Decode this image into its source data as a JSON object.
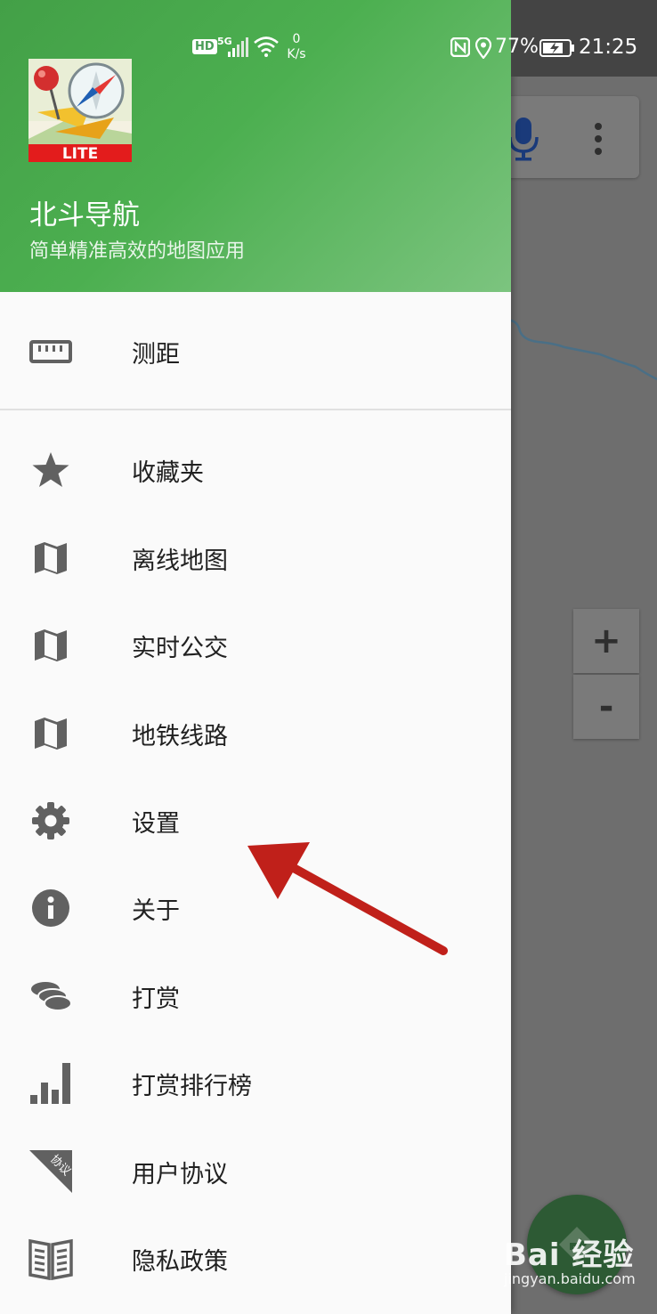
{
  "status_bar": {
    "hd": "HD",
    "network": "5G",
    "speed_value": "0",
    "speed_unit": "K/s",
    "battery": "77%",
    "time": "21:25"
  },
  "header": {
    "app_title": "北斗导航",
    "app_subtitle": "简单精准高效的地图应用",
    "logo_badge": "LITE"
  },
  "menu": {
    "top_items": [
      {
        "label": "测距",
        "icon": "ruler-icon"
      }
    ],
    "items": [
      {
        "label": "收藏夹",
        "icon": "star-icon"
      },
      {
        "label": "离线地图",
        "icon": "map-icon"
      },
      {
        "label": "实时公交",
        "icon": "map-icon"
      },
      {
        "label": "地铁线路",
        "icon": "map-icon"
      },
      {
        "label": "设置",
        "icon": "gear-icon"
      },
      {
        "label": "关于",
        "icon": "info-icon"
      },
      {
        "label": "打赏",
        "icon": "coins-icon"
      },
      {
        "label": "打赏排行榜",
        "icon": "bar-chart-icon"
      },
      {
        "label": "用户协议",
        "icon": "agreement-icon"
      },
      {
        "label": "隐私政策",
        "icon": "book-icon"
      }
    ],
    "agreement_icon_text": "协议"
  },
  "map_controls": {
    "zoom_in": "+",
    "zoom_out": "-"
  },
  "watermark": {
    "brand": "Bai 经验",
    "url": "jingyan.baidu.com"
  },
  "colors": {
    "header_green": "#4caf50",
    "arrow_red": "#c0201a",
    "icon_gray": "#616161"
  }
}
